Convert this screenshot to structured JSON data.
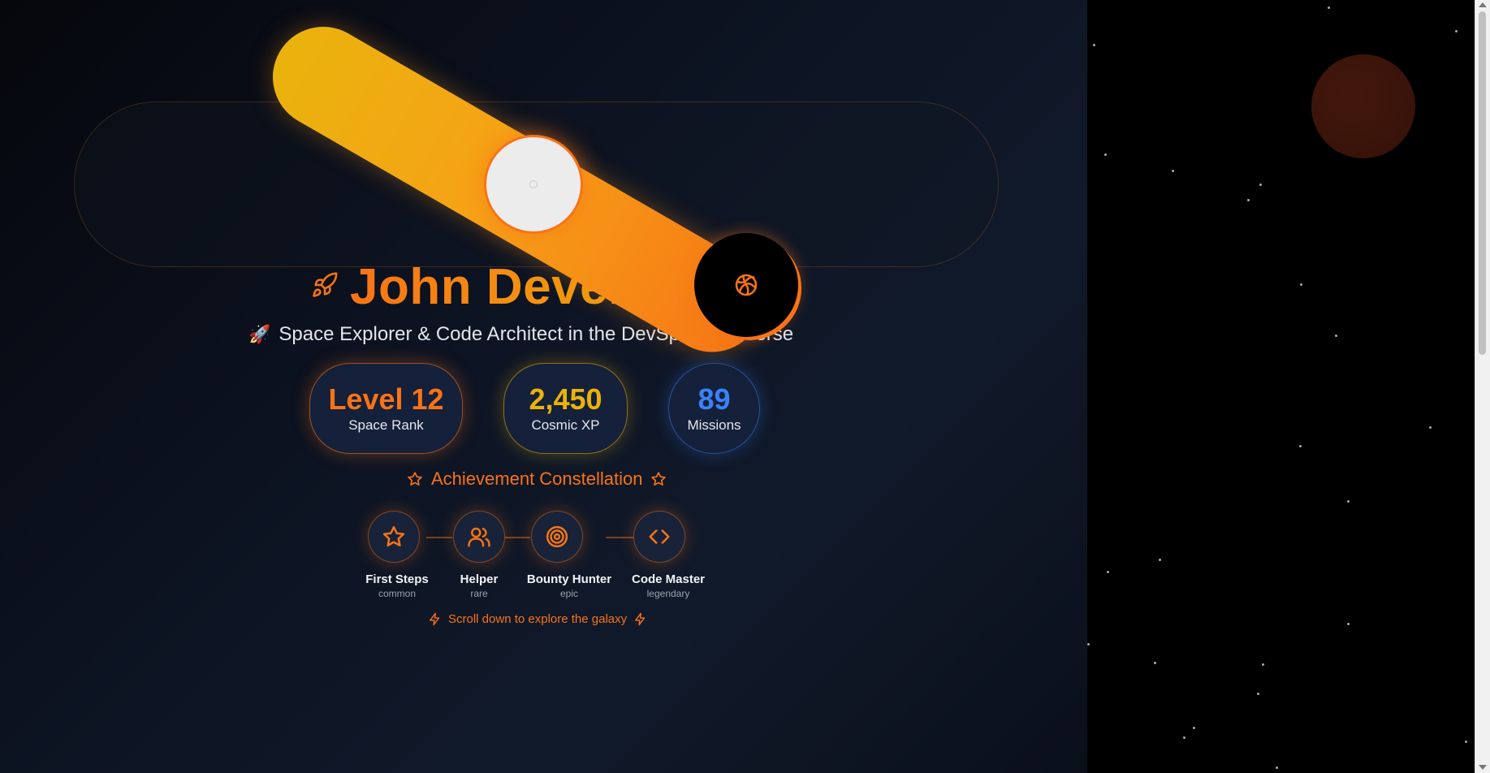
{
  "hero": {
    "name": "John Developer",
    "subtitle_emoji": "🚀",
    "subtitle": "Space Explorer & Code Architect in the DevSpace Universe"
  },
  "stats": [
    {
      "value": "Level 12",
      "label": "Space Rank",
      "color": "#f97316"
    },
    {
      "value": "2,450",
      "label": "Cosmic XP",
      "color": "#eab308"
    },
    {
      "value": "89",
      "label": "Missions",
      "color": "#3b82f6"
    }
  ],
  "achievements": {
    "title": "Achievement Constellation",
    "items": [
      {
        "name": "First Steps",
        "rarity": "common",
        "icon": "star-icon"
      },
      {
        "name": "Helper",
        "rarity": "rare",
        "icon": "users-icon"
      },
      {
        "name": "Bounty Hunter",
        "rarity": "epic",
        "icon": "target-icon"
      },
      {
        "name": "Code Master",
        "rarity": "legendary",
        "icon": "code-icon"
      }
    ]
  },
  "scroll_hint": "Scroll down to explore the galaxy",
  "colors": {
    "accent": "#f97316",
    "gold": "#eab308",
    "blue": "#3b82f6"
  }
}
